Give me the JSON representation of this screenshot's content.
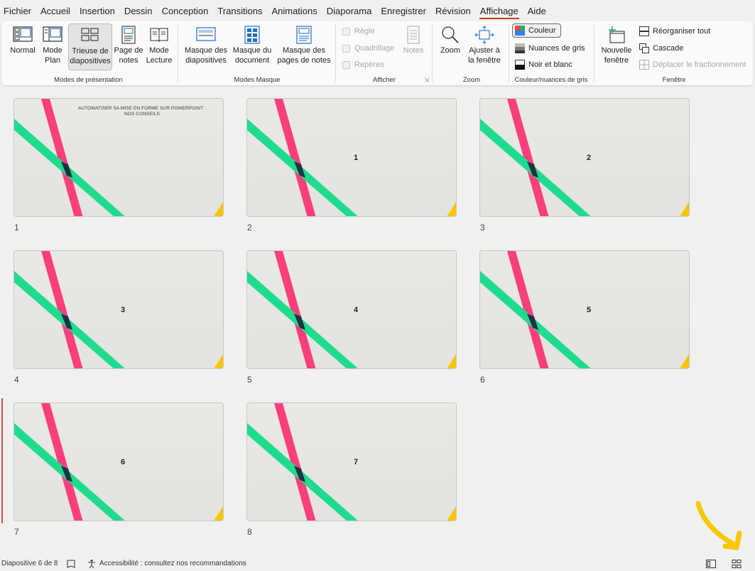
{
  "menu": {
    "items": [
      "Fichier",
      "Accueil",
      "Insertion",
      "Dessin",
      "Conception",
      "Transitions",
      "Animations",
      "Diaporama",
      "Enregistrer",
      "Révision",
      "Affichage",
      "Aide"
    ],
    "active_index": 10
  },
  "ribbon": {
    "modes_presentation": {
      "label": "Modes de présentation",
      "normal": "Normal",
      "mode_plan": "Mode\nPlan",
      "trieuse": "Trieuse de\ndiapositives",
      "page_notes": "Page de\nnotes",
      "mode_lecture": "Mode\nLecture"
    },
    "modes_masque": {
      "label": "Modes Masque",
      "masque_diapos": "Masque des\ndiapositives",
      "masque_document": "Masque du\ndocument",
      "masque_notes": "Masque des\npages de notes"
    },
    "afficher": {
      "label": "Afficher",
      "regle": "Règle",
      "quadrillage": "Quadrillage",
      "reperes": "Repères",
      "notes": "Notes"
    },
    "zoom": {
      "label": "Zoom",
      "zoom": "Zoom",
      "ajuster": "Ajuster à\nla fenêtre"
    },
    "couleur": {
      "label": "Couleur/nuances de gris",
      "couleur": "Couleur",
      "nuances": "Nuances de gris",
      "noir_blanc": "Noir et blanc"
    },
    "fenetre": {
      "label": "Fenêtre",
      "nouvelle": "Nouvelle\nfenêtre",
      "reorganiser": "Réorganiser tout",
      "cascade": "Cascade",
      "deplacer": "Déplacer le fractionnement"
    }
  },
  "slides": [
    {
      "index": "1",
      "title": "AUTOMATISER SA MISE EN FORME SUR POWERPOINT :\nNOS CONSEILS",
      "number": ""
    },
    {
      "index": "2",
      "title": "",
      "number": "1"
    },
    {
      "index": "3",
      "title": "",
      "number": "2"
    },
    {
      "index": "4",
      "title": "",
      "number": "3"
    },
    {
      "index": "5",
      "title": "",
      "number": "4"
    },
    {
      "index": "6",
      "title": "",
      "number": "5"
    },
    {
      "index": "7",
      "title": "",
      "number": "6"
    },
    {
      "index": "8",
      "title": "",
      "number": "7"
    }
  ],
  "colors": {
    "accent_tab": "#c43e1c",
    "stripe_pink": "#fb3f7c",
    "stripe_green": "#1fdb8e",
    "stripe_overlap": "#1e3344",
    "corner_yellow": "#f7c600",
    "annotation_yellow": "#f8c800"
  },
  "status": {
    "slide_counter": "Diapositive 6 de 8",
    "accessibility": "Accessibilité : consultez nos recommandations"
  }
}
